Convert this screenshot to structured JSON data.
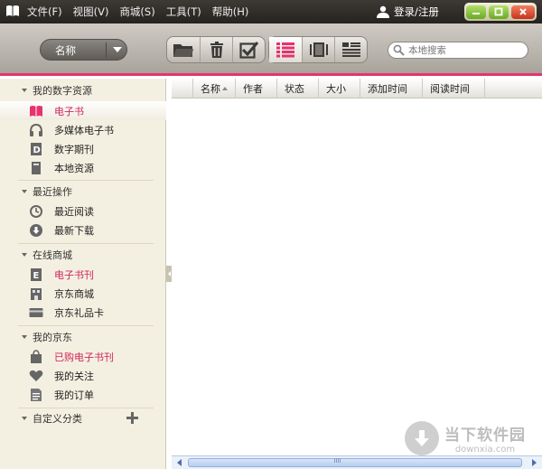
{
  "menubar": {
    "items": [
      {
        "label": "文件(F)"
      },
      {
        "label": "视图(V)"
      },
      {
        "label": "商城(S)"
      },
      {
        "label": "工具(T)"
      },
      {
        "label": "帮助(H)"
      }
    ],
    "login_label": "登录/注册"
  },
  "toolbar": {
    "sort_value": "名称",
    "search_placeholder": "本地搜索",
    "tools": [
      "folder-icon",
      "trash-icon",
      "checkbox-icon",
      "list-view-icon",
      "book-view-icon",
      "detail-view-icon"
    ]
  },
  "sidebar": {
    "sections": [
      {
        "title": "我的数字资源",
        "items": [
          {
            "label": "电子书",
            "icon": "book-icon",
            "selected": true
          },
          {
            "label": "多媒体电子书",
            "icon": "headphones-icon"
          },
          {
            "label": "数字期刊",
            "icon": "journal-icon"
          },
          {
            "label": "本地资源",
            "icon": "local-file-icon"
          }
        ]
      },
      {
        "title": "最近操作",
        "items": [
          {
            "label": "最近阅读",
            "icon": "clock-icon"
          },
          {
            "label": "最新下载",
            "icon": "download-icon"
          }
        ]
      },
      {
        "title": "在线商城",
        "items": [
          {
            "label": "电子书刊",
            "icon": "ebook-store-icon",
            "red": true
          },
          {
            "label": "京东商城",
            "icon": "store-icon"
          },
          {
            "label": "京东礼品卡",
            "icon": "gift-card-icon"
          }
        ]
      },
      {
        "title": "我的京东",
        "items": [
          {
            "label": "已购电子书刊",
            "icon": "bag-icon",
            "red": true
          },
          {
            "label": "我的关注",
            "icon": "heart-icon"
          },
          {
            "label": "我的订单",
            "icon": "order-icon"
          }
        ]
      }
    ],
    "custom_category": "自定义分类"
  },
  "table": {
    "columns": [
      "名称",
      "作者",
      "状态",
      "大小",
      "添加时间",
      "阅读时间"
    ]
  },
  "watermark": {
    "title": "当下软件园",
    "site": "downxia.com"
  },
  "colors": {
    "accent": "#e8326e",
    "link_red": "#d0245c",
    "titlebar": "#2e2b27",
    "sidebar_bg": "#f4f0e1"
  }
}
